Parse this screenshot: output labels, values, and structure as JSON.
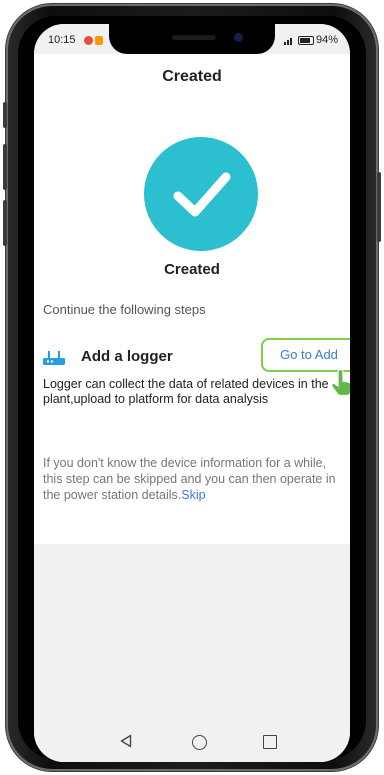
{
  "status_bar": {
    "time": "10:15",
    "battery": "94%"
  },
  "page": {
    "title": "Created",
    "success_label": "Created"
  },
  "steps": {
    "header": "Continue the following steps",
    "logger": {
      "title": "Add a logger",
      "button": "Go to Add",
      "description": "Logger can collect the data of related devices in the plant,upload to platform for data analysis"
    },
    "skip_notice": "If you don't know the device information for a while, this step can be skipped and you can then operate in the power station details.",
    "skip_link": "Skip"
  },
  "colors": {
    "success": "#2bbfcf",
    "link": "#3b7ad9",
    "highlight": "#7ecf4a"
  },
  "icons": {
    "success": "checkmark-icon",
    "logger": "router-icon",
    "pointer": "hand-pointer-icon"
  }
}
